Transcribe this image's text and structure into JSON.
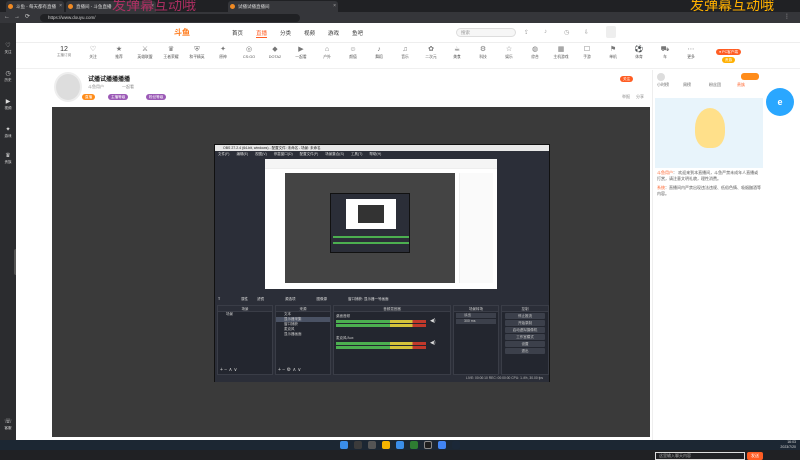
{
  "colors": {
    "accent": "#ff5d23",
    "overlay": "#c0306a",
    "overlay_right": "#ffb000",
    "obs_bg": "#2b2e38"
  },
  "overlay": {
    "left_text": "发弹幕互动哦",
    "right_text": "发弹幕互动哦"
  },
  "browser": {
    "tabs": [
      {
        "label": "斗鱼 - 每天都有直播"
      },
      {
        "label": "直播间 - 斗鱼直播"
      },
      {
        "label": "试播试播直播间"
      }
    ],
    "url": "https://www.douyu.com/",
    "left_rail": [
      {
        "icon": "heart-icon",
        "label": "关注"
      },
      {
        "icon": "clock-icon",
        "label": "历史"
      },
      {
        "icon": "video-icon",
        "label": "视频"
      },
      {
        "icon": "game-icon",
        "label": "游戏"
      },
      {
        "icon": "crown-icon",
        "label": "贵族"
      }
    ],
    "left_rail_bottom": "客服"
  },
  "site": {
    "logo": "斗鱼",
    "nav": [
      "首页",
      "直播",
      "分类",
      "视频",
      "游戏",
      "鱼吧"
    ],
    "active_nav_index": 1,
    "search_placeholder": "搜索",
    "categories": [
      "关注",
      "推荐",
      "英雄联盟",
      "王者荣耀",
      "和平精英",
      "原神",
      "CS:GO",
      "DOTA2",
      "一起看",
      "户外",
      "颜值",
      "舞蹈",
      "音乐",
      "二次元",
      "美食",
      "科技",
      "娱乐",
      "综合",
      "主机游戏",
      "手游",
      "单机",
      "体育",
      "车",
      "更多"
    ],
    "count_label": "12",
    "count_sub": "主播订阅"
  },
  "room": {
    "title": "试播试播播播播",
    "streamer": "斗鱼用户",
    "category": "一起看",
    "follow_label": "关注",
    "badges": [
      "直播",
      "主播等级",
      "粉丝等级"
    ],
    "report_label": "举报",
    "share_label": "分享"
  },
  "obs": {
    "title": "OBS 27.2.4 (64-bit, windows) - 配置文件: 未命名 - 场景: 未命名",
    "menu": [
      "文件(F)",
      "编辑(E)",
      "视图(V)",
      "停靠窗口(D)",
      "配置文件(P)",
      "场景集合(S)",
      "工具(T)",
      "帮助(H)"
    ],
    "controls": [
      "属性",
      "滤镜",
      "源选项",
      "图像源",
      "窗口捕获: 显示器一号画面"
    ],
    "docks": {
      "scenes": {
        "title": "场景",
        "items": [
          "场景"
        ]
      },
      "sources": {
        "title": "来源",
        "items": [
          "文本",
          "显示器采集",
          "窗口捕获",
          "麦克风",
          "显示器画面"
        ]
      },
      "mixer": {
        "title": "音频混音器",
        "tracks": [
          "桌面音频",
          "麦克风/Aux"
        ]
      },
      "transitions": {
        "title": "场景转场",
        "type": "淡出",
        "duration": "300 ms"
      },
      "controls": {
        "title": "控制",
        "buttons": [
          "停止推流",
          "开始录制",
          "启动虚拟摄像机",
          "工作室模式",
          "设置",
          "退出"
        ]
      }
    },
    "status": "LIVE: 00:00:10   REC: 00:00:00   CPU: 1.4%, 30.00 fps"
  },
  "right_panel": {
    "tabs": [
      "小时榜",
      "周榜",
      "粉丝团",
      "贵族"
    ],
    "chat": [
      {
        "user": "斗鱼用户",
        "text": "欢迎来到本直播间，斗鱼严禁未成年人直播或打赏，请注意文明礼貌，理性消费。"
      },
      {
        "user": "系统",
        "text": "直播间内严禁出现违法违规、低俗色情、吸烟酗酒等内容。"
      }
    ],
    "chat_placeholder": "这里输入聊天内容",
    "send_label": "发送"
  },
  "taskbar": {
    "time": "16:03",
    "date": "2023/7/20"
  }
}
